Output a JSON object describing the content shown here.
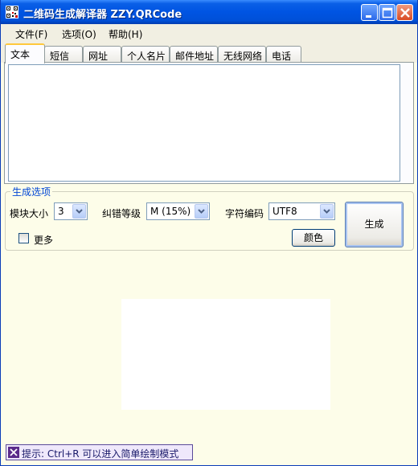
{
  "window": {
    "title": "二维码生成解译器 ZZY.QRCode",
    "icon": "qr-code-icon"
  },
  "titlebar_buttons": [
    "minimize-icon",
    "maximize-icon",
    "close-icon"
  ],
  "menu": {
    "items": [
      {
        "label": "文件(F)"
      },
      {
        "label": "选项(O)"
      },
      {
        "label": "帮助(H)"
      }
    ]
  },
  "tabs": [
    {
      "label": "文本",
      "active": true
    },
    {
      "label": "短信"
    },
    {
      "label": "网址"
    },
    {
      "label": "个人名片"
    },
    {
      "label": "邮件地址"
    },
    {
      "label": "无线网络"
    },
    {
      "label": "电话"
    }
  ],
  "text_input": {
    "value": ""
  },
  "options": {
    "legend": "生成选项",
    "module_size_label": "模块大小",
    "module_size_value": "3",
    "ecc_label": "纠错等级",
    "ecc_value": "M (15%)",
    "encoding_label": "字符编码",
    "encoding_value": "UTF8",
    "more_label": "更多",
    "more_checked": false,
    "color_button": "颜色",
    "generate_button": "生成"
  },
  "status": {
    "text": "提示: Ctrl+R 可以进入简单绘制模式",
    "icon": "close-icon"
  },
  "colors": {
    "titlebar": "#0054e3",
    "window_bg": "#fdfde9",
    "legend": "#0046d5"
  }
}
